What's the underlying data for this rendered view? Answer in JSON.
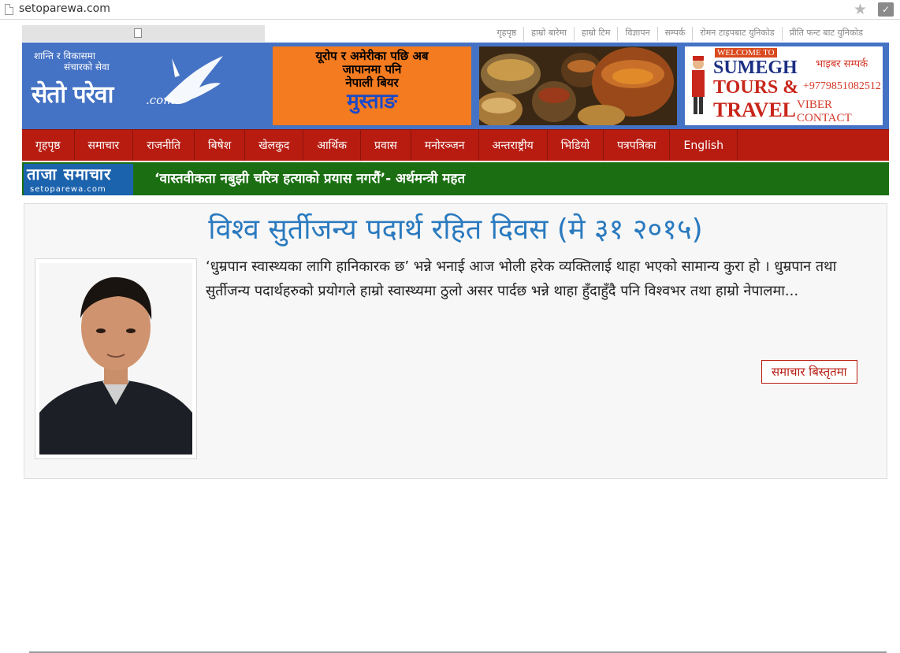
{
  "browser": {
    "url": "setoparewa.com"
  },
  "toplinks": [
    "गृहपृष्ठ",
    "हाम्रो बारेमा",
    "हाम्रो टिम",
    "विज्ञापन",
    "सम्पर्क",
    "रोमन टाइपबाट युनिकोड",
    "प्रीति फन्ट बाट युनिकोड"
  ],
  "logo": {
    "tagline_line1": "शान्ति र विकासमा",
    "tagline_line2": "संचारको सेवा",
    "name": "सेतो परेवा",
    "suffix": ".com"
  },
  "ads": {
    "beer": {
      "line1": "यूरोप र अमेरीका पछि अब",
      "line2": "जापानमा पनि",
      "line3": "नेपाली बियर",
      "brand": "मुस्ताङ"
    },
    "tours": {
      "welcome": "WELCOME TO",
      "line1": "SUMEGH",
      "line2": "TOURS &",
      "line3": "TRAVEL",
      "contact_np": "भाइबर सम्पर्क",
      "phone": "+9779851082512",
      "viber": "VIBER CONTACT"
    }
  },
  "nav": [
    "गृहपृष्ठ",
    "समाचार",
    "राजनीति",
    "बिषेश",
    "खेलकुद",
    "आर्थिक",
    "प्रवास",
    "मनोरञ्जन",
    "अन्तराष्ट्रीय",
    "भिडियो",
    "पत्रपत्रिका",
    "English"
  ],
  "breaking": {
    "label": "ताजा समाचार",
    "sublabel": "setoparewa.com",
    "headline": "‘वास्तवीकता नबुझी चरित्र हत्याको प्रयास नगरौं’- अर्थमन्त्री महत"
  },
  "article": {
    "title": "विश्व सुर्तीजन्य पदार्थ रहित दिवस (मे ३१ २०१५)",
    "excerpt": "‘धुम्रपान स्वास्थ्यका लागि हानिकारक छ’ भन्ने भनाई आज भोली हरेक व्यक्तिलाई थाहा भएको सामान्य कुरा हो । धुम्रपान तथा सुर्तीजन्य पदार्थहरुको प्रयोगले हाम्रो स्वास्थ्यमा ठुलो असर पार्दछ भन्ने थाहा हुँदाहुँदै पनि विश्वभर तथा हाम्रो नेपालमा...",
    "more_label": "समाचार बिस्तृतमा"
  },
  "colors": {
    "nav_red": "#b81c11",
    "banner_blue": "#4472c4",
    "breaking_green": "#1b6f12",
    "title_blue": "#2a7abf"
  }
}
